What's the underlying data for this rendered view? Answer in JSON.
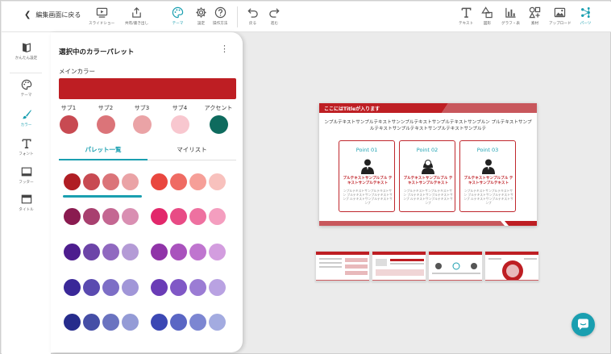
{
  "toolbar": {
    "back_label": "編集画面に戻る",
    "left_buttons": [
      "スライドショー",
      "共有/書き出し",
      "テーマ",
      "設定",
      "操作方法",
      "戻る",
      "進む"
    ],
    "right_buttons": [
      "テキスト",
      "図形",
      "グラフ・表",
      "素材",
      "アップロード",
      "パーツ"
    ]
  },
  "rail": {
    "items": [
      "かんたん設定",
      "テーマ",
      "カラー",
      "フォント",
      "フッター",
      "タイトル"
    ],
    "active": "カラー"
  },
  "panel": {
    "title": "選択中のカラーパレット",
    "main_label": "メインカラー",
    "main_color": "#be1e23",
    "subs": [
      {
        "label": "サブ1",
        "color": "#c84a52"
      },
      {
        "label": "サブ2",
        "color": "#db7479"
      },
      {
        "label": "サブ3",
        "color": "#eaa3a6"
      },
      {
        "label": "サブ4",
        "color": "#f8c7cf"
      },
      {
        "label": "アクセント",
        "color": "#0e6b5e"
      }
    ],
    "tabs": [
      "パレット一覧",
      "マイリスト"
    ],
    "active_tab": "パレット一覧",
    "palettes": [
      [
        [
          "#b01e24",
          "#c84a52",
          "#db7479",
          "#eaa3a6"
        ],
        [
          "#e9473f",
          "#ef6b63",
          "#f69f98",
          "#f8c1bd"
        ]
      ],
      [
        [
          "#8a1b50",
          "#a8406f",
          "#c46792",
          "#d98fb2"
        ],
        [
          "#e2286b",
          "#e84b85",
          "#ee71a0",
          "#f49ebf"
        ]
      ],
      [
        [
          "#4d1d8e",
          "#6c44a8",
          "#9069c0",
          "#b49bd6"
        ],
        [
          "#9034a8",
          "#a952bd",
          "#bf75cf",
          "#d39ddf"
        ]
      ],
      [
        [
          "#3a2898",
          "#5a4ab0",
          "#7d6ec6",
          "#a196d8"
        ],
        [
          "#6a3cb6",
          "#8058c6",
          "#9b7cd4",
          "#b9a2e2"
        ]
      ],
      [
        [
          "#262c8c",
          "#454ea6",
          "#6a73c0",
          "#949bd6"
        ],
        [
          "#3c48b4",
          "#5a66c4",
          "#7c86d2",
          "#a3abe0"
        ]
      ]
    ],
    "selected_palette": "1"
  },
  "slide": {
    "title": "ここにはTitleが入ります",
    "body": "ンプルテキストサンプルテキストサンンプルテキストサンプルテキストサンプルン プルテキストサンプルテキストサンプルテキストサンプルテキストサンプルテ",
    "cards": [
      {
        "title": "Point 01",
        "red": "ブルテキストサンプルブル テキストサンプルテキスト",
        "gray": "ンプルテキストサンプルテキストサン プルテキストサンプルテキストサンプ ルテキストサンプルテキストサンプ"
      },
      {
        "title": "Point 02",
        "red": "ブルテキストサンプルブル テキストサンプルテキスト",
        "gray": "ンプルテキストサンプルテキストサン プルテキストサンプルテキストサンプ ルテキストサンプルテキストサンプ"
      },
      {
        "title": "Point 03",
        "red": "ブルテキストサンプルブル テキストサンプルテキスト",
        "gray": "ンプルテキストサンプルテキストサン プルテキストサンプルテキストサンプ ルテキストサンプルテキストサンプ"
      }
    ]
  },
  "colors": {
    "accent": "#1a9fb0",
    "brand_red": "#c0272d"
  }
}
